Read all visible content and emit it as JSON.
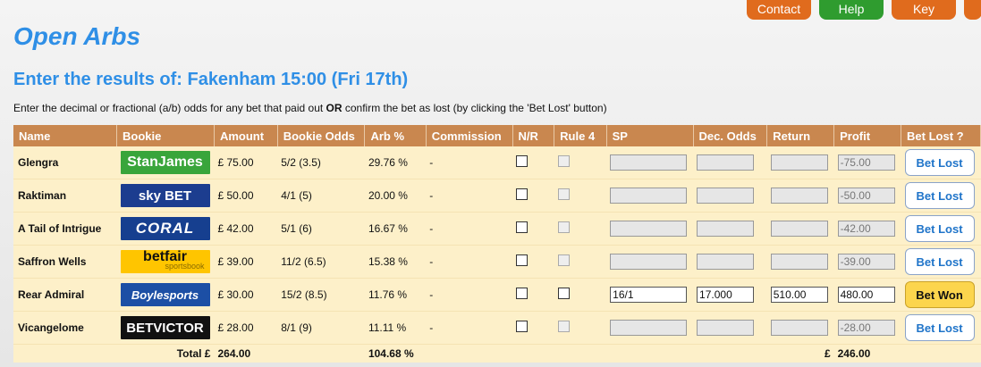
{
  "nav": {
    "contact": "Contact",
    "help": "Help",
    "key": "Key"
  },
  "page_title": "Open Arbs",
  "subtitle": "Enter the results of: Fakenham 15:00 (Fri 17th)",
  "instruction": {
    "pre": "Enter the decimal or fractional (a/b) odds for any bet that paid out ",
    "or": "OR",
    "post": " confirm the bet as lost (by clicking the 'Bet Lost' button)"
  },
  "columns": [
    "Name",
    "Bookie",
    "Amount",
    "Bookie Odds",
    "Arb %",
    "Commission",
    "N/R",
    "Rule 4",
    "SP",
    "Dec. Odds",
    "Return",
    "Profit",
    "Bet Lost ?"
  ],
  "rows": [
    {
      "name": "Glengra",
      "bookie": "StanJames",
      "amount": "£ 75.00",
      "odds": "5/2 (3.5)",
      "arb": "29.76 %",
      "commission": "-",
      "sp": "",
      "dec": "",
      "ret": "",
      "profit": "-75.00",
      "button": "Bet Lost"
    },
    {
      "name": "Raktiman",
      "bookie": "sky BET",
      "amount": "£ 50.00",
      "odds": "4/1 (5)",
      "arb": "20.00 %",
      "commission": "-",
      "sp": "",
      "dec": "",
      "ret": "",
      "profit": "-50.00",
      "button": "Bet Lost"
    },
    {
      "name": "A Tail of Intrigue",
      "bookie": "CORAL",
      "amount": "£ 42.00",
      "odds": "5/1 (6)",
      "arb": "16.67 %",
      "commission": "-",
      "sp": "",
      "dec": "",
      "ret": "",
      "profit": "-42.00",
      "button": "Bet Lost"
    },
    {
      "name": "Saffron Wells",
      "bookie": "betfair",
      "bookie_sub": "sportsbook",
      "amount": "£ 39.00",
      "odds": "11/2 (6.5)",
      "arb": "15.38 %",
      "commission": "-",
      "sp": "",
      "dec": "",
      "ret": "",
      "profit": "-39.00",
      "button": "Bet Lost"
    },
    {
      "name": "Rear Admiral",
      "bookie": "Boylesports",
      "amount": "£ 30.00",
      "odds": "15/2 (8.5)",
      "arb": "11.76 %",
      "commission": "-",
      "sp": "16/1",
      "dec": "17.000",
      "ret": "510.00",
      "profit": "480.00",
      "button": "Bet Won"
    },
    {
      "name": "Vicangelome",
      "bookie": "BETVICTOR",
      "amount": "£ 28.00",
      "odds": "8/1 (9)",
      "arb": "11.11 %",
      "commission": "-",
      "sp": "",
      "dec": "",
      "ret": "",
      "profit": "-28.00",
      "button": "Bet Lost"
    }
  ],
  "totals": {
    "label": "Total £",
    "amount": "264.00",
    "arb": "104.68 %",
    "profit_label": "£",
    "profit": "246.00"
  },
  "colors": {
    "accent": "#2f8fe6",
    "header": "#c9874f",
    "row": "#fdf0c9",
    "won": "#fcd54d"
  }
}
